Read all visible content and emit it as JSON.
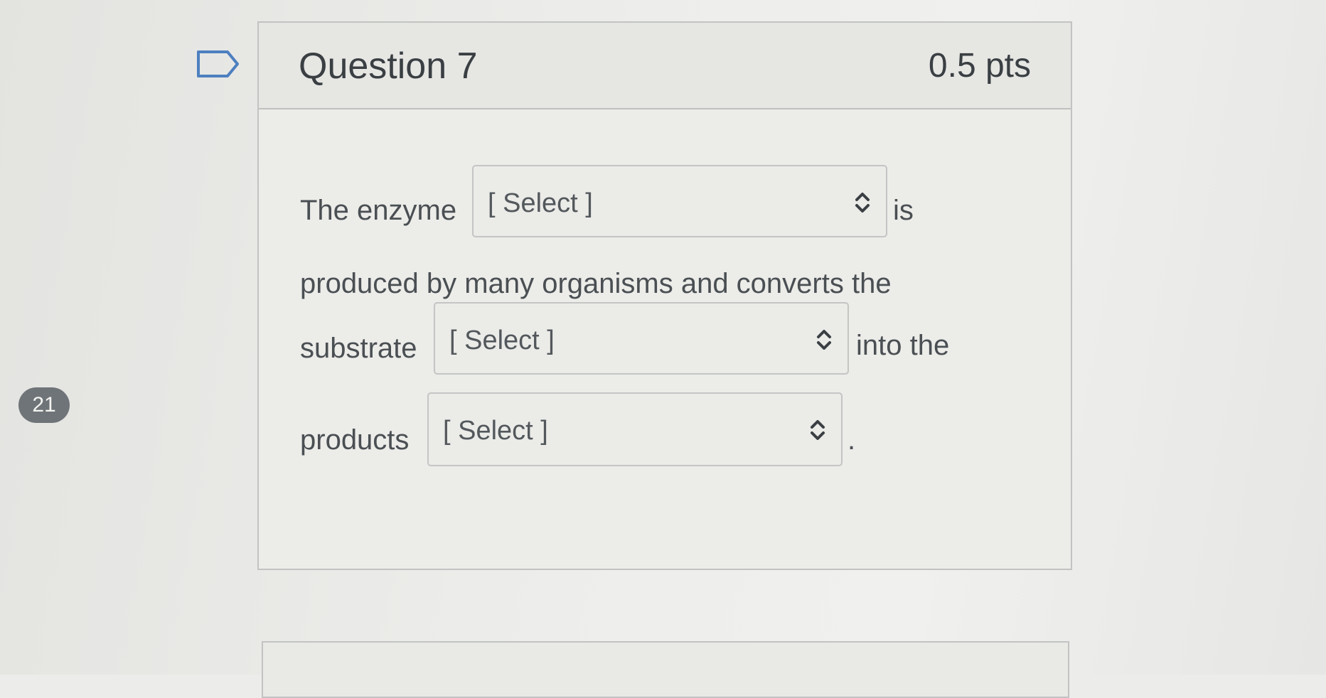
{
  "question": {
    "title": "Question 7",
    "points": "0.5 pts",
    "number_badge": "21",
    "text": {
      "seg1": "The enzyme",
      "seg2": "is",
      "seg3": "produced by many organisms and converts the",
      "seg4": "substrate",
      "seg5": "into the",
      "seg6": "products",
      "seg7": "."
    },
    "selects": [
      {
        "value": "[ Select ]"
      },
      {
        "value": "[ Select ]"
      },
      {
        "value": "[ Select ]"
      }
    ]
  },
  "icons": {
    "flag": "flag-icon",
    "dropdown": "chevron-up-down-icon"
  },
  "colors": {
    "background": "#ececea",
    "badge": "#6f7478",
    "text": "#3d4246",
    "border": "#c2c4c3"
  }
}
